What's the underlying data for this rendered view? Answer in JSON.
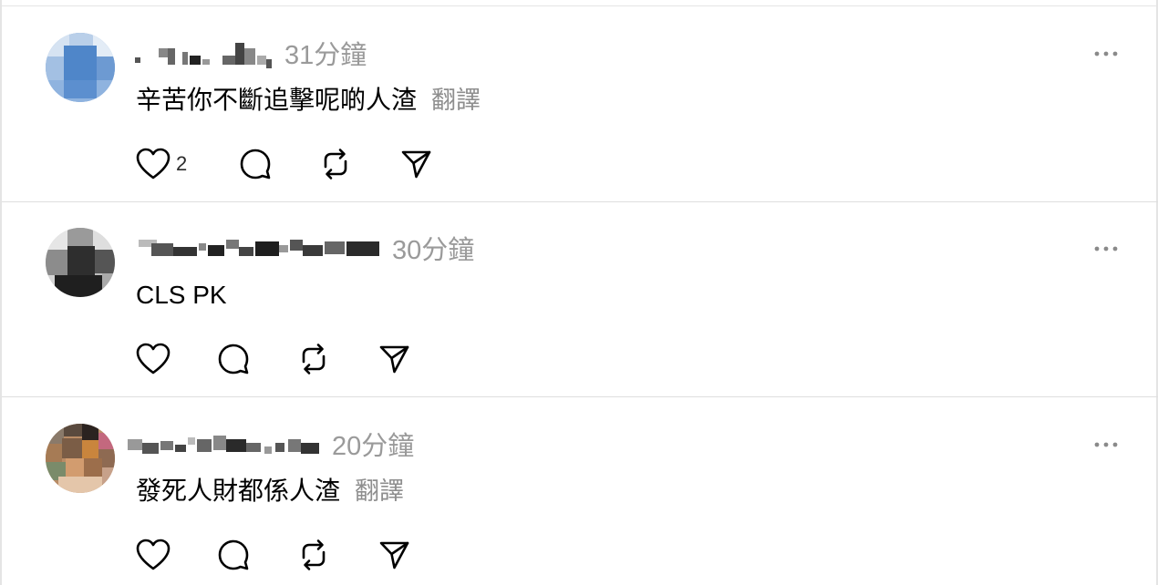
{
  "posts": [
    {
      "time": "31分鐘",
      "comment": "辛苦你不斷追擊呢啲人渣",
      "translate": "翻譯",
      "like_count": "2",
      "more_icon": "ellipsis-icon"
    },
    {
      "time": "30分鐘",
      "comment": "CLS PK",
      "translate": "",
      "like_count": "",
      "more_icon": "ellipsis-icon"
    },
    {
      "time": "20分鐘",
      "comment": "發死人財都係人渣",
      "translate": "翻譯",
      "like_count": "",
      "more_icon": "ellipsis-icon"
    }
  ],
  "icons": {
    "like": "heart-icon",
    "reply": "comment-bubble-icon",
    "repost": "repost-icon",
    "share": "send-icon",
    "more": "more-dots-icon"
  },
  "colors": {
    "divider": "#dedede",
    "meta_text": "#9a9a9a",
    "translate_text": "#8e8e8e",
    "icon_stroke": "#000000"
  },
  "more_label": "···"
}
